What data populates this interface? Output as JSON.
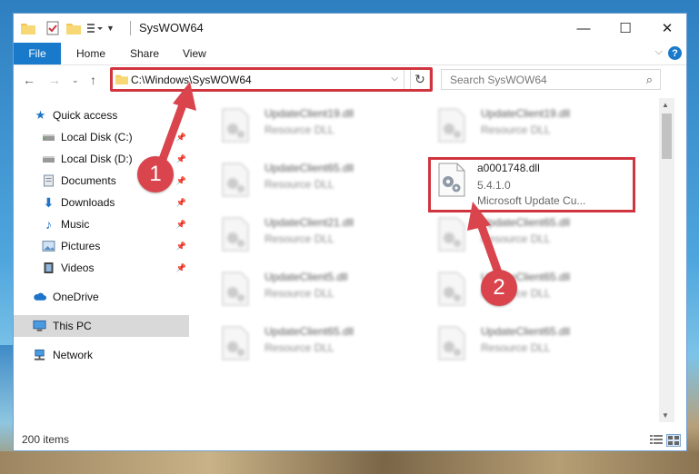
{
  "window": {
    "title": "SysWOW64",
    "controls": {
      "minimize": "—",
      "maximize": "☐",
      "close": "✕"
    }
  },
  "ribbon": {
    "tabs": [
      "File",
      "Home",
      "Share",
      "View"
    ],
    "collapse_icon": "chevron-down-icon",
    "help": "?"
  },
  "address_bar": {
    "path": "C:\\Windows\\SysWOW64",
    "search_placeholder": "Search SysWOW64"
  },
  "sidebar": {
    "items": [
      {
        "label": "Quick access",
        "icon": "star-icon",
        "pinned": false
      },
      {
        "label": "Local Disk (C:)",
        "icon": "drive-icon",
        "pinned": true
      },
      {
        "label": "Local Disk (D:)",
        "icon": "drive-icon",
        "pinned": true
      },
      {
        "label": "Documents",
        "icon": "documents-icon",
        "pinned": true
      },
      {
        "label": "Downloads",
        "icon": "download-icon",
        "pinned": true
      },
      {
        "label": "Music",
        "icon": "music-icon",
        "pinned": true
      },
      {
        "label": "Pictures",
        "icon": "pictures-icon",
        "pinned": true
      },
      {
        "label": "Videos",
        "icon": "videos-icon",
        "pinned": true
      },
      {
        "label": "OneDrive",
        "icon": "cloud-icon",
        "pinned": false
      },
      {
        "label": "This PC",
        "icon": "computer-icon",
        "pinned": false,
        "selected": true
      },
      {
        "label": "Network",
        "icon": "network-icon",
        "pinned": false
      }
    ]
  },
  "files": {
    "left": [
      {
        "name": "UpdateClient19.dll",
        "type": "Resource DLL"
      },
      {
        "name": "UpdateClient65.dll",
        "type": "Resource DLL"
      },
      {
        "name": "UpdateClient21.dll",
        "type": "Resource DLL"
      },
      {
        "name": "UpdateClient5.dll",
        "type": "Resource DLL"
      },
      {
        "name": "UpdateClient65.dll",
        "type": "Resource DLL"
      }
    ],
    "right": [
      {
        "name": "UpdateClient19.dll",
        "type": "Resource DLL"
      },
      {
        "name": "a0001748.dll",
        "type": "5.4.1.0",
        "extra": "Microsoft Update Cu..."
      },
      {
        "name": "UpdateClient65.dll",
        "type": "Resource DLL"
      },
      {
        "name": "UpdateClient65.dll",
        "type": "Resource DLL"
      },
      {
        "name": "UpdateClient65.dll",
        "type": "Resource DLL"
      }
    ]
  },
  "status": {
    "item_count": "200 items"
  },
  "annotations": {
    "badge1": "1",
    "badge2": "2",
    "highlight_color": "#d0353f"
  }
}
